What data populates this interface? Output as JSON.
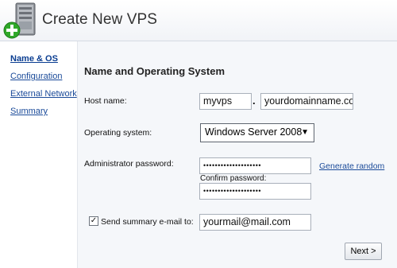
{
  "header": {
    "title": "Create New VPS",
    "icon": "server-add-icon"
  },
  "sidebar": {
    "items": [
      {
        "label": "Name & OS",
        "active": true
      },
      {
        "label": "Configuration",
        "active": false
      },
      {
        "label": "External Network",
        "active": false
      },
      {
        "label": "Summary",
        "active": false
      }
    ]
  },
  "form": {
    "section_title": "Name and Operating System",
    "host_label": "Host name:",
    "host_value": "myvps",
    "domain_separator": ".",
    "domain_value": "yourdomainname.com",
    "os_label": "Operating system:",
    "os_value": "Windows Server 2008",
    "os_arrow": "▼",
    "admin_label": "Administrator password:",
    "admin_mask": "••••••••••••••••••••",
    "generate_label": "Generate random",
    "confirm_label": "Confirm password:",
    "confirm_mask": "••••••••••••••••••••",
    "send_label": "Send summary e-mail to:",
    "send_checked": true,
    "checkbox_mark": "✓",
    "email_value": "yourmail@mail.com"
  },
  "footer": {
    "next_label": "Next >"
  },
  "colors": {
    "link": "#1a4a99",
    "panel_bg": "#f5f7fa",
    "header_bg": "#f1f3f7",
    "accent_green": "#2fa829"
  }
}
